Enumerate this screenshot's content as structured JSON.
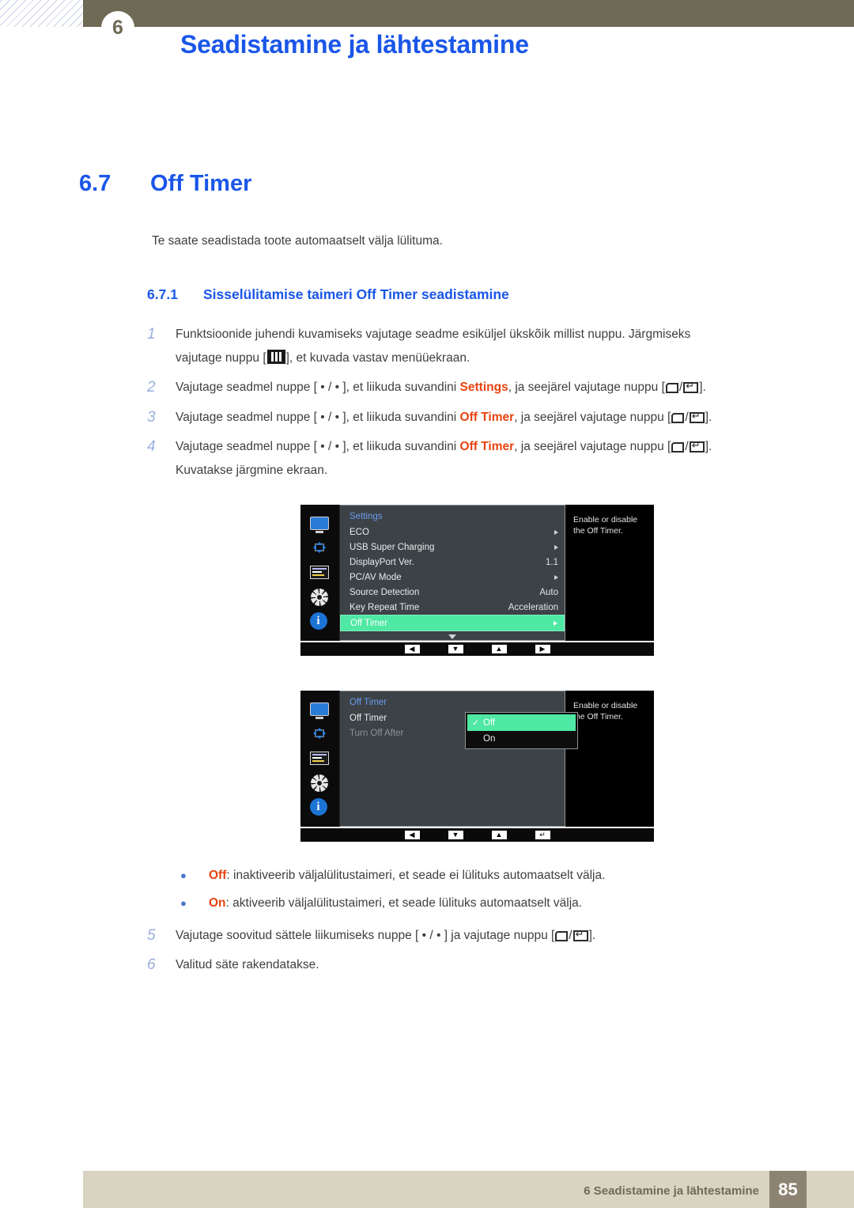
{
  "header": {
    "chapter_number": "6",
    "title": "Seadistamine ja lähtestamine"
  },
  "section": {
    "number": "6.7",
    "title": "Off Timer",
    "intro": "Te saate seadistada toote automaatselt välja lülituma.",
    "sub_number": "6.7.1",
    "sub_title": "Sisselülitamise taimeri Off Timer seadistamine"
  },
  "steps": [
    {
      "num": "1",
      "part1": "Funktsioonide juhendi kuvamiseks vajutage seadme esiküljel ükskõik millist nuppu. Järgmiseks",
      "part2_pre": "vajutage nuppu [",
      "part2_post": "], et kuvada vastav menüüekraan."
    },
    {
      "num": "2",
      "pre": "Vajutage seadmel nuppe [ • / • ], et liikuda suvandini ",
      "keyword": "Settings",
      "mid": ", ja seejärel vajutage nuppu [",
      "post": "]."
    },
    {
      "num": "3",
      "pre": "Vajutage seadmel nuppe [ • / • ], et liikuda suvandini ",
      "keyword": "Off Timer",
      "mid": ", ja seejärel vajutage nuppu [",
      "post": "]."
    },
    {
      "num": "4",
      "pre": "Vajutage seadmel nuppe [ • / • ], et liikuda suvandini ",
      "keyword": "Off Timer",
      "mid": ", ja seejärel vajutage nuppu [",
      "post": "].",
      "extra": "Kuvatakse järgmine ekraan."
    },
    {
      "num": "5",
      "pre": "Vajutage soovitud sättele liikumiseks nuppe [ • / • ] ja vajutage nuppu [",
      "post": "]."
    },
    {
      "num": "6",
      "text": "Valitud säte rakendatakse."
    }
  ],
  "osd1": {
    "title": "Settings",
    "rows": [
      {
        "label": "ECO",
        "value": "",
        "arrow": true,
        "selected": false
      },
      {
        "label": "USB Super Charging",
        "value": "",
        "arrow": true,
        "selected": false
      },
      {
        "label": "DisplayPort Ver.",
        "value": "1.1",
        "arrow": false,
        "selected": false
      },
      {
        "label": "PC/AV Mode",
        "value": "",
        "arrow": true,
        "selected": false
      },
      {
        "label": "Source Detection",
        "value": "Auto",
        "arrow": false,
        "selected": false
      },
      {
        "label": "Key Repeat Time",
        "value": "Acceleration",
        "arrow": false,
        "selected": false
      },
      {
        "label": "Off Timer",
        "value": "",
        "arrow": true,
        "selected": true
      }
    ],
    "help": "Enable or disable the Off Timer.",
    "footer_buttons": [
      "◀",
      "▼",
      "▲",
      "▶"
    ]
  },
  "osd2": {
    "title": "Off Timer",
    "rows": [
      {
        "label": "Off Timer",
        "dim": false
      },
      {
        "label": "Turn Off After",
        "dim": true
      }
    ],
    "options": [
      {
        "label": "Off",
        "checked": true,
        "selected": true
      },
      {
        "label": "On",
        "checked": false,
        "selected": false
      }
    ],
    "help": "Enable or disable the Off Timer.",
    "footer_buttons": [
      "◀",
      "▼",
      "▲",
      "↵"
    ]
  },
  "bullets": [
    {
      "keyword": "Off",
      "text": ": inaktiveerib väljalülitustaimeri, et seade ei lülituks automaatselt välja."
    },
    {
      "keyword": "On",
      "text": ": aktiveerib väljalülitustaimeri, et seade lülituks automaatselt välja."
    }
  ],
  "footer": {
    "text": "6 Seadistamine ja lähtestamine",
    "page": "85"
  },
  "colors": {
    "accent_blue": "#1a56e8",
    "keyword_orange": "#e8430f",
    "header_olive": "#6e6a55",
    "footer_beige": "#d9d4c2",
    "osd_green": "#4fe8a4"
  }
}
